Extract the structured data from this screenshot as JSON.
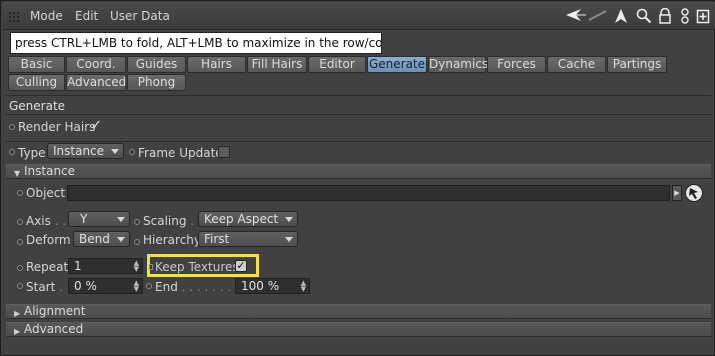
{
  "menubar": {
    "items": [
      "Mode",
      "Edit",
      "User Data"
    ],
    "icons": [
      "back-arrow-icon",
      "forward-arrow-icon",
      "up-arrow-icon",
      "search-icon",
      "lock-icon",
      "hierarchy-icon",
      "new-window-icon"
    ]
  },
  "tooltip": "press CTRL+LMB to fold, ALT+LMB to maximize in the row/column",
  "tabs": {
    "row1": [
      "Basic",
      "Coord.",
      "Guides",
      "Hairs",
      "Fill Hairs",
      "Editor",
      "Generate",
      "Dynamics",
      "Forces",
      "Cache",
      "Partings"
    ],
    "row2": [
      "Culling",
      "Advanced",
      "Phong"
    ],
    "active": "Generate"
  },
  "section": {
    "title": "Generate",
    "render_hairs": "Render Hairs",
    "type_label": "Type",
    "type_value": "Instance",
    "frame_update": "Frame Update"
  },
  "instance": {
    "title": "Instance",
    "object_label": "Object",
    "axis_label": "Axis",
    "axis_value": "Y",
    "scaling_label": "Scaling",
    "scaling_value": "Keep Aspect",
    "deform_label": "Deform",
    "deform_value": "Bend",
    "hierarchy_label": "Hierarchy",
    "hierarchy_value": "First",
    "repeat_label": "Repeat",
    "repeat_value": "1",
    "keep_textures": "Keep Textures",
    "start_label": "Start",
    "start_value": "0 %",
    "end_label": "End",
    "end_value": "100 %"
  },
  "groups": {
    "alignment": "Alignment",
    "advanced": "Advanced"
  },
  "colors": {
    "active_tab": "#7fa0c6",
    "highlight": "#f2e04a"
  }
}
